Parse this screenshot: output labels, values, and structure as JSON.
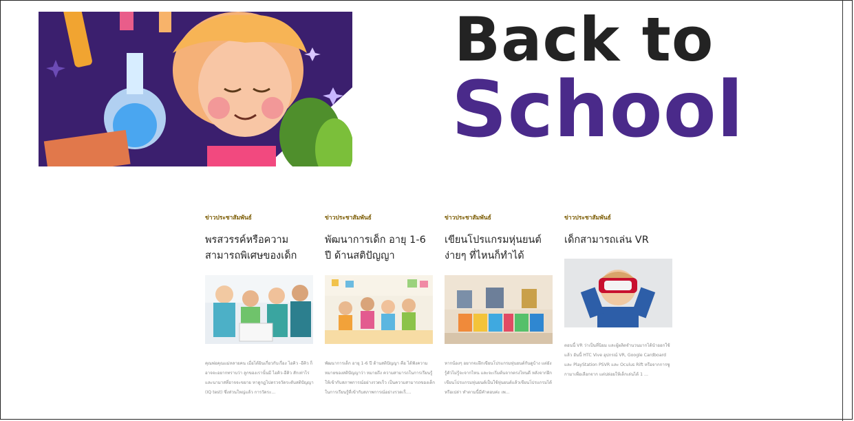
{
  "banner": {
    "line1": "Back to",
    "line2": "School",
    "colors": {
      "line1": "#232323",
      "line2": "#4a2a8a",
      "art_bg": "#3b1f6e"
    },
    "art_icon": "child-science-illustration-icon"
  },
  "cards": [
    {
      "category": "ข่าวประชาสัมพันธ์",
      "title": "พรสวรรค์หรือความสามารถพิเศษของเด็ก",
      "image_icon": "children-tablet-photo",
      "excerpt": "คุณพ่อคุณแม่หลายคน เมื่อได้ยินเกี่ยวกับเรื่อง ไอคิว -อีคิว ก็อาจจะอยากทราบว่า ลูกของเรานั้นมี ไอคิว-อีคิว สักเท่าไร และนามาสที่อาจจะขยาย หาดูกฏไปตรวจวัดระดับสติปัญญา (IQ test) ซึ่งส่วนใหญ่แล้ว การวัดระ..."
    },
    {
      "category": "ข่าวประชาสัมพันธ์",
      "title": "พัฒนาการเด็ก อายุ 1-6 ปี ด้านสติปัญญา",
      "image_icon": "kids-classroom-photo",
      "excerpt": "พัฒนาการเด็ก อายุ 1-6 ปี ด้านสติปัญญา คือ ได้ฟังความหมายของสติปัญญาว่า หมายถึง ความสามารถในการเรียนรู้ให้เข้ากับสภาพการณ์อย่างรวดเร็ว เป็นความสามารถของเด็กในการเรียนรู้ที่เข้ากับสภาพการณ์อย่างรวดเร็...."
    },
    {
      "category": "ข่าวประชาสัมพันธ์",
      "title": "เขียนโปรแกรมหุ่นยนต์ง่ายๆ ที่ไหนก็ทำได้",
      "image_icon": "coding-robots-photo",
      "excerpt": "หากน้องๆ อยากจะฝึกเขียนโปรแกรมหุ่นยนต์กันดูบ้าง แต่ยังรู้ตัวไม่รู้จะจากไหน และจะเริ่มต้นจากตรงไหนดี หลังจากฝึกเขียนโปรแกรมหุ่นยนต์เป็นใช้หุ่นยนต์แล้วเขียนโปรแกรมได้หรือเปล่า ทำตามนี้มีคำตอบค่ะ เพ..."
    },
    {
      "category": "ข่าวประชาสัมพันธ์",
      "title": "เด็กสามารถเล่น VR",
      "image_icon": "child-vr-headset-photo",
      "excerpt": "ตอนนี้ VR ว่าเป็นที่นิยม และผู้ผลิตจำนวนมากได้นำออกใช้แล้ว อันนี้ HTC Vive อุปกรณ์ VR, Google Cardboard และ PlayStation PSVR และ Oculus Rift หรือจากการซูกามาเพื่อเลือกจาก แต่ปล่อยให้เด็กเล่นได้ 1 ..."
    }
  ]
}
